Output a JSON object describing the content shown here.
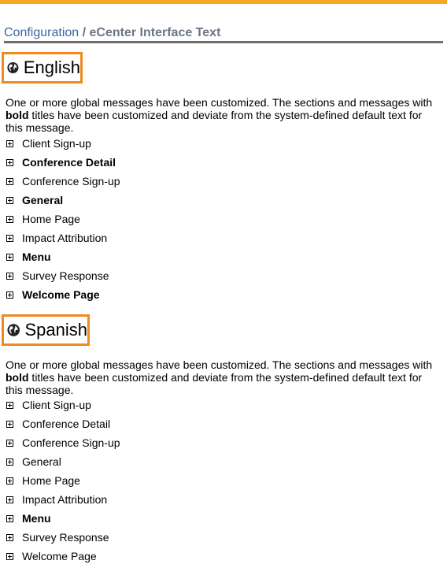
{
  "breadcrumb": {
    "root": "Configuration",
    "separator": " / ",
    "current": "eCenter Interface Text"
  },
  "languages": [
    {
      "name": "English",
      "icon": "globe-icon",
      "description_prefix": "One or more global messages have been customized. The sections and messages with ",
      "description_bold": "bold",
      "description_suffix": " titles have been customized and deviate from the system-defined default text for this message.",
      "sections": [
        {
          "label": "Client Sign-up",
          "customized": false
        },
        {
          "label": "Conference Detail",
          "customized": true
        },
        {
          "label": "Conference Sign-up",
          "customized": false
        },
        {
          "label": "General",
          "customized": true
        },
        {
          "label": "Home Page",
          "customized": false
        },
        {
          "label": "Impact Attribution",
          "customized": false
        },
        {
          "label": "Menu",
          "customized": true
        },
        {
          "label": "Survey Response",
          "customized": false
        },
        {
          "label": "Welcome Page",
          "customized": true
        }
      ]
    },
    {
      "name": "Spanish",
      "icon": "globe-icon",
      "description_prefix": "One or more global messages have been customized. The sections and messages with ",
      "description_bold": "bold",
      "description_suffix": " titles have been customized and deviate from the system-defined default text for this message.",
      "sections": [
        {
          "label": "Client Sign-up",
          "customized": false
        },
        {
          "label": "Conference Detail",
          "customized": false
        },
        {
          "label": "Conference Sign-up",
          "customized": false
        },
        {
          "label": "General",
          "customized": false
        },
        {
          "label": "Home Page",
          "customized": false
        },
        {
          "label": "Impact Attribution",
          "customized": false
        },
        {
          "label": "Menu",
          "customized": true
        },
        {
          "label": "Survey Response",
          "customized": false
        },
        {
          "label": "Welcome Page",
          "customized": false
        }
      ]
    }
  ],
  "colors": {
    "accent_bar": "#f5a623",
    "highlight_box": "#f0891f",
    "breadcrumb_link": "#3a66a0"
  }
}
